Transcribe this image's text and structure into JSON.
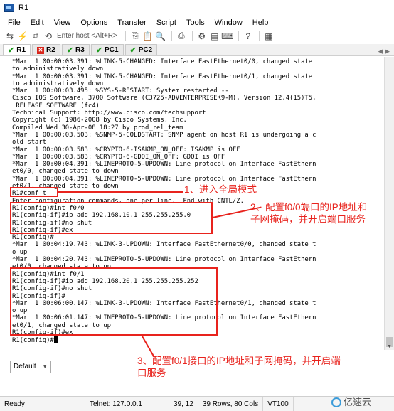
{
  "window": {
    "title": "R1"
  },
  "menu": [
    "File",
    "Edit",
    "View",
    "Options",
    "Transfer",
    "Script",
    "Tools",
    "Window",
    "Help"
  ],
  "toolbar": {
    "host_placeholder": "Enter host <Alt+R>"
  },
  "tabs": [
    {
      "label": "R1",
      "status": "ok",
      "active": true
    },
    {
      "label": "R2",
      "status": "error",
      "active": false
    },
    {
      "label": "R3",
      "status": "ok",
      "active": false
    },
    {
      "label": "PC1",
      "status": "ok",
      "active": false
    },
    {
      "label": "PC2",
      "status": "ok",
      "active": false
    }
  ],
  "terminal_lines": [
    "*Mar  1 00:00:03.391: %LINK-5-CHANGED: Interface FastEthernet0/0, changed state",
    "to administratively down",
    "*Mar  1 00:00:03.391: %LINK-5-CHANGED: Interface FastEthernet0/1, changed state",
    "to administratively down",
    "*Mar  1 00:00:03.495: %SYS-5-RESTART: System restarted --",
    "Cisco IOS Software, 3700 Software (C3725-ADVENTERPRISEK9-M), Version 12.4(15)T5,",
    " RELEASE SOFTWARE (fc4)",
    "Technical Support: http://www.cisco.com/techsupport",
    "Copyright (c) 1986-2008 by Cisco Systems, Inc.",
    "Compiled Wed 30-Apr-08 18:27 by prod_rel_team",
    "*Mar  1 00:00:03.503: %SNMP-5-COLDSTART: SNMP agent on host R1 is undergoing a c",
    "old start",
    "*Mar  1 00:00:03.583: %CRYPTO-6-ISAKMP_ON_OFF: ISAKMP is OFF",
    "*Mar  1 00:00:03.583: %CRYPTO-6-GDOI_ON_OFF: GDOI is OFF",
    "*Mar  1 00:00:04.391: %LINEPROTO-5-UPDOWN: Line protocol on Interface FastEthern",
    "et0/0, changed state to down",
    "*Mar  1 00:00:04.391: %LINEPROTO-5-UPDOWN: Line protocol on Interface FastEthern",
    "et0/1, changed state to down",
    "R1#conf t",
    "Enter configuration commands, one per line.  End with CNTL/Z.",
    "R1(config)#int f0/0",
    "R1(config-if)#ip add 192.168.10.1 255.255.255.0",
    "R1(config-if)#no shut",
    "R1(config-if)#ex",
    "R1(config)#",
    "*Mar  1 00:04:19.743: %LINK-3-UPDOWN: Interface FastEthernet0/0, changed state t",
    "o up",
    "*Mar  1 00:04:20.743: %LINEPROTO-5-UPDOWN: Line protocol on Interface FastEthern",
    "et0/0, changed state to up",
    "R1(config)#int f0/1",
    "R1(config-if)#ip add 192.168.20.1 255.255.255.252",
    "R1(config-if)#no shut",
    "R1(config-if)#",
    "*Mar  1 00:06:00.147: %LINK-3-UPDOWN: Interface FastEthernet0/1, changed state t",
    "o up",
    "*Mar  1 00:06:01.147: %LINEPROTO-5-UPDOWN: Line protocol on Interface FastEthern",
    "et0/1, changed state to up",
    "R1(config-if)#ex",
    "R1(config)#"
  ],
  "annotations": {
    "note1": "1、进入全局模式",
    "note2": "2、配置f0/0端口的IP地址和\n子网掩码，并开启端口服务",
    "note3": "3、配置f0/1接口的IP地址和子网掩码，并开启端\n口服务",
    "color": "#e8231d"
  },
  "session": {
    "selected": "Default"
  },
  "status": {
    "state": "Ready",
    "connection": "Telnet: 127.0.0.1",
    "cursor": "39, 12",
    "size": "39 Rows, 80 Cols",
    "emulation": "VT100"
  },
  "watermark": "亿速云"
}
